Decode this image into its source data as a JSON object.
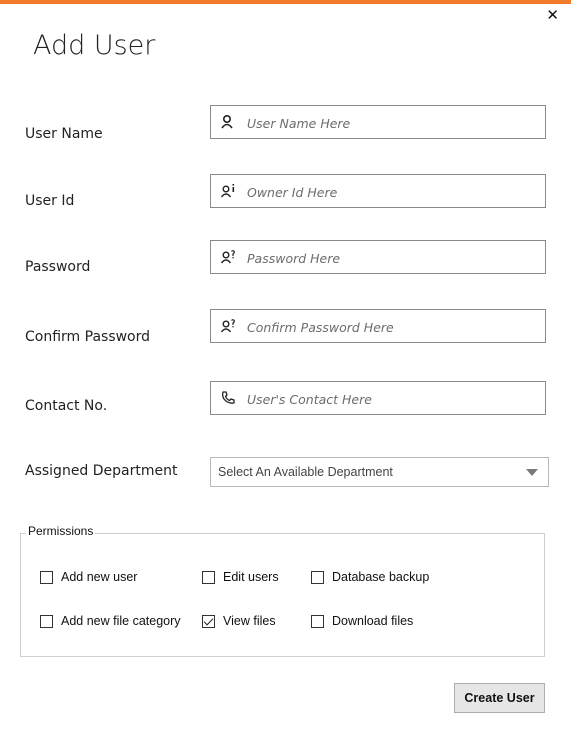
{
  "window": {
    "title": "Add User",
    "close_glyph": "✕",
    "accent_color": "#f07b2a"
  },
  "fields": [
    {
      "label": "User Name",
      "placeholder": "User Name Here",
      "icon": "user-icon"
    },
    {
      "label": "User Id",
      "placeholder": "Owner Id Here",
      "icon": "user-info-icon"
    },
    {
      "label": "Password",
      "placeholder": "Password Here",
      "icon": "user-key-icon"
    },
    {
      "label": "Confirm Password",
      "placeholder": "Confirm Password Here",
      "icon": "user-key-icon"
    },
    {
      "label": "Contact No.",
      "placeholder": "User's Contact Here",
      "icon": "phone-icon"
    }
  ],
  "department": {
    "label": "Assigned Department",
    "selected": "Select An Available Department"
  },
  "permissions": {
    "title": "Permissions",
    "items": [
      {
        "label": "Add new user",
        "checked": false
      },
      {
        "label": "Edit users",
        "checked": false
      },
      {
        "label": "Database backup",
        "checked": false
      },
      {
        "label": "Add new file category",
        "checked": false
      },
      {
        "label": "View files",
        "checked": true
      },
      {
        "label": "Download files",
        "checked": false
      }
    ]
  },
  "actions": {
    "create_label": "Create User"
  }
}
